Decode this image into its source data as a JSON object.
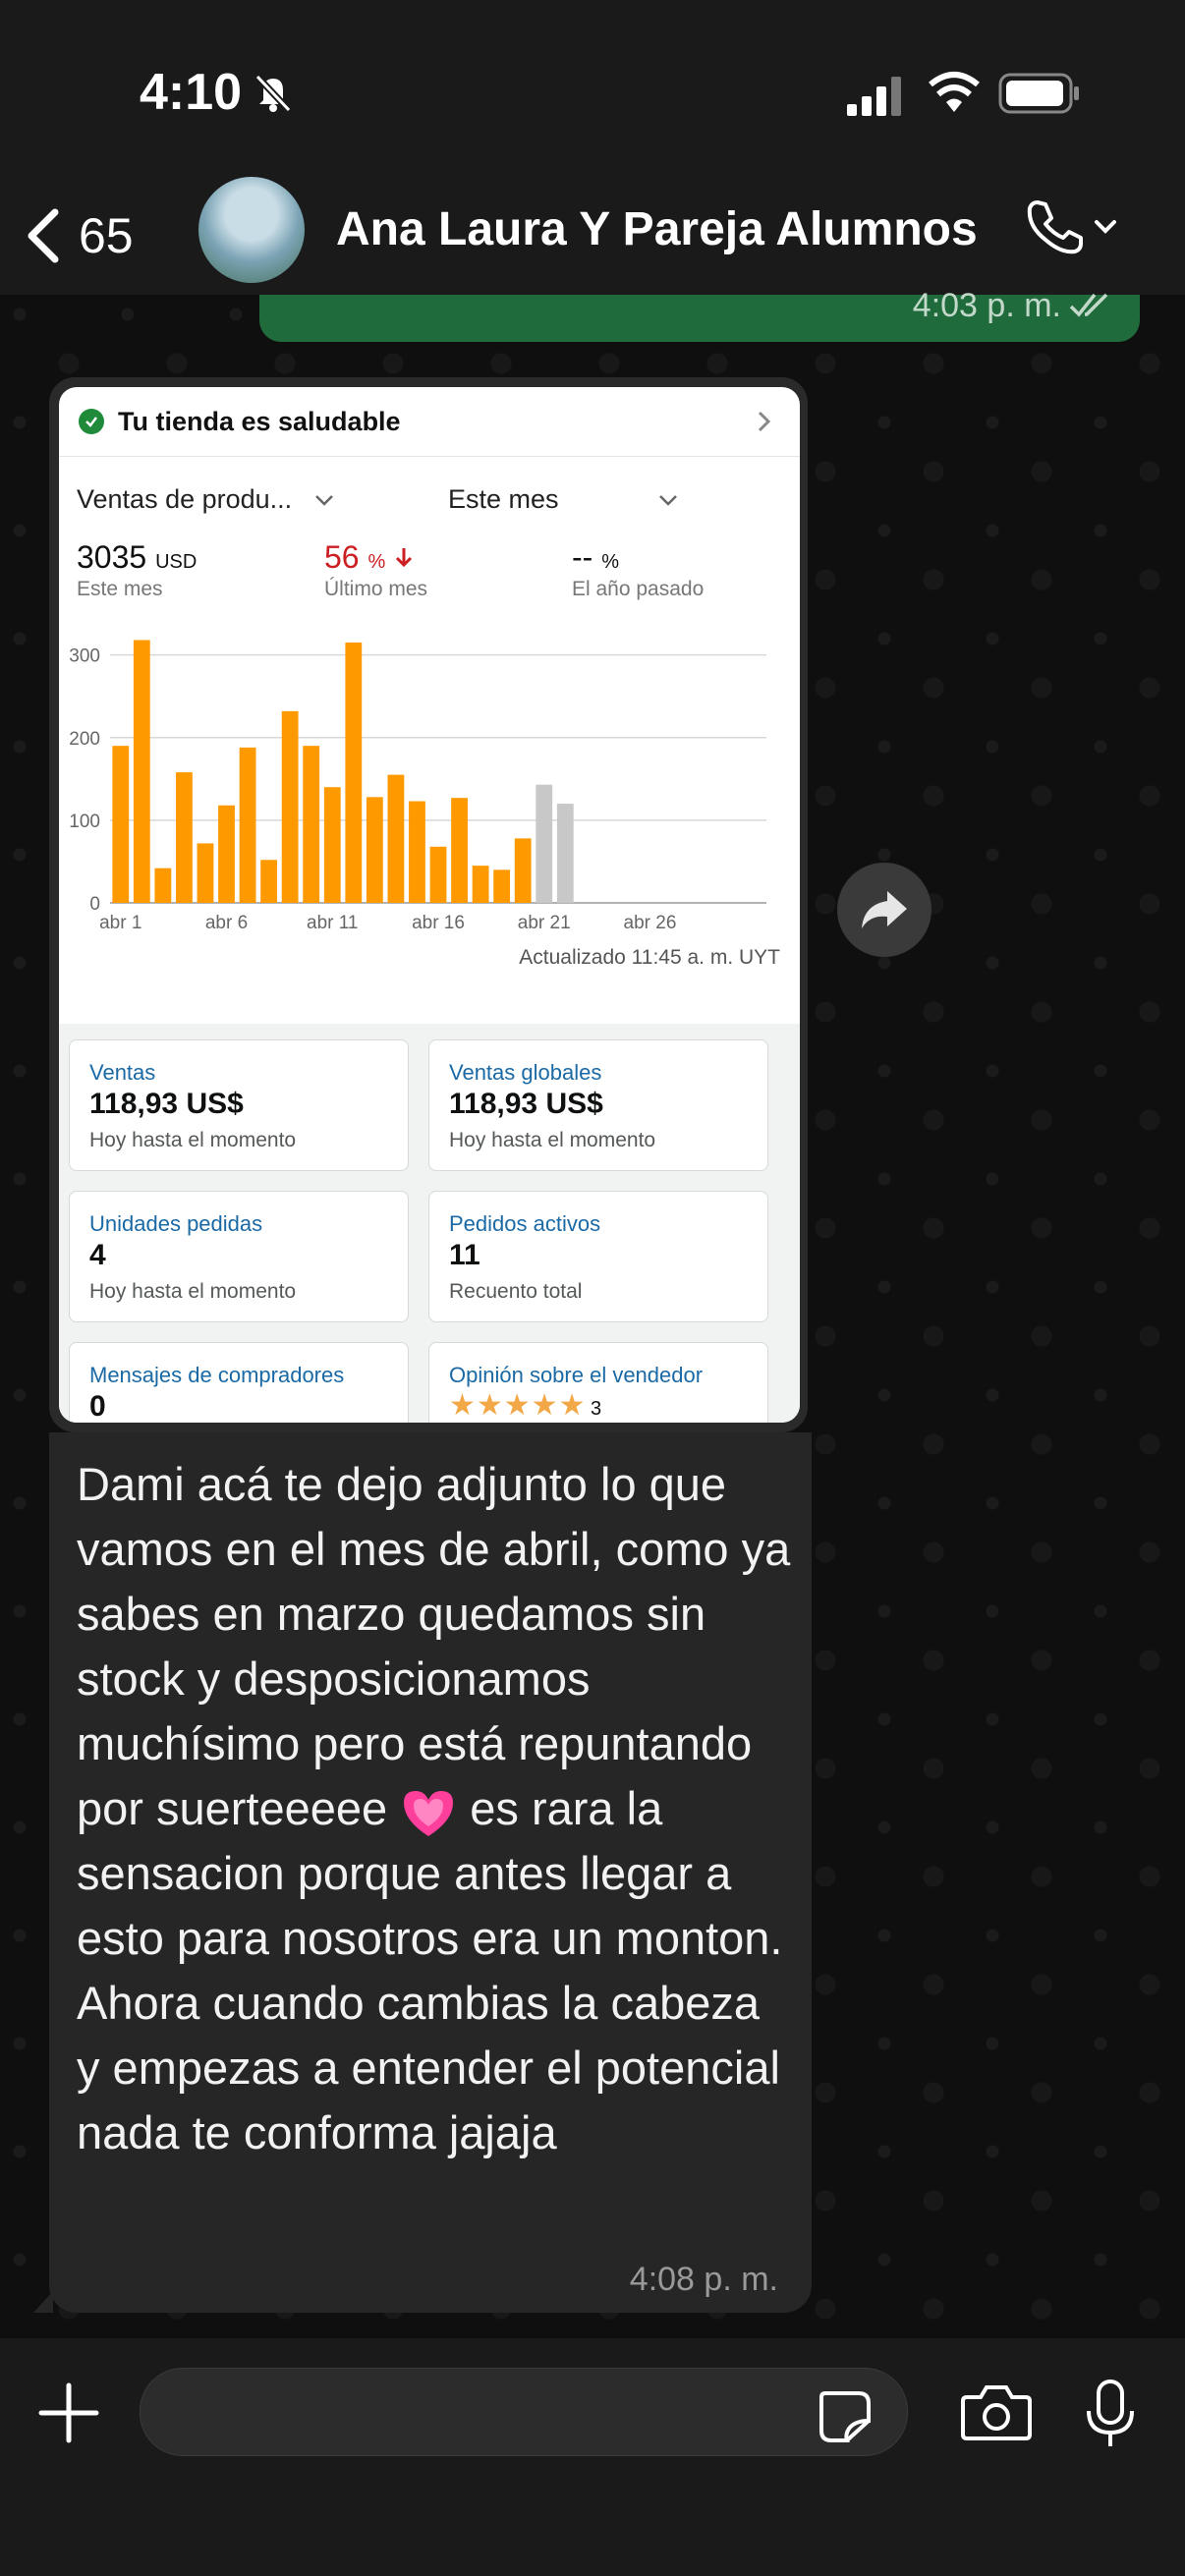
{
  "status": {
    "time": "4:10"
  },
  "header": {
    "back_count": "65",
    "title": "Ana Laura Y Pareja Alumnos"
  },
  "prev_message": {
    "time": "4:03 p. m."
  },
  "screenshot": {
    "health": "Tu tienda es saludable",
    "filter_left": "Ventas de produ...",
    "filter_right": "Este mes",
    "metrics": [
      {
        "value": "3035",
        "unit": "USD",
        "label": "Este mes"
      },
      {
        "value": "56",
        "unit": "%",
        "label": "Último mes"
      },
      {
        "value": "--",
        "unit": "%",
        "label": "El año pasado"
      }
    ],
    "updated": "Actualizado 11:45 a. m. UYT",
    "cards": [
      {
        "label": "Ventas",
        "value": "118,93 US$",
        "sub": "Hoy hasta el momento"
      },
      {
        "label": "Ventas globales",
        "value": "118,93 US$",
        "sub": "Hoy hasta el momento"
      },
      {
        "label": "Unidades pedidas",
        "value": "4",
        "sub": "Hoy hasta el momento"
      },
      {
        "label": "Pedidos activos",
        "value": "11",
        "sub": "Recuento total"
      },
      {
        "label": "Mensajes de compradores",
        "value": "0"
      },
      {
        "label": "Opinión sobre el vendedor",
        "stars": "★★★★★",
        "count": "3"
      }
    ]
  },
  "message": {
    "text": "Dami acá te dejo adjunto lo que vamos en el mes de abril, como ya sabes en marzo quedamos sin stock y desposicionamos muchísimo pero está repuntando por suerteeeee",
    "text_after": "es rara la sensacion porque antes llegar a esto para nosotros era un monton. Ahora cuando cambias la cabeza y empezas a entender el potencial nada te conforma jajaja",
    "time": "4:08 p. m."
  },
  "chart_data": {
    "type": "bar",
    "x": [
      1,
      2,
      3,
      4,
      5,
      6,
      7,
      8,
      9,
      10,
      11,
      12,
      13,
      14,
      15,
      16,
      17,
      18,
      19,
      20,
      21,
      22
    ],
    "values": [
      190,
      318,
      42,
      158,
      72,
      118,
      188,
      52,
      232,
      190,
      140,
      315,
      128,
      155,
      123,
      68,
      127,
      45,
      40,
      78,
      143,
      120
    ],
    "highlight_color": "#ff9900",
    "projected_from_index": 20,
    "projected_color": "#c8c8c8",
    "xtick_labels": [
      "abr 1",
      "abr 6",
      "abr 11",
      "abr 16",
      "abr 21",
      "abr 26"
    ],
    "xtick_positions": [
      1,
      6,
      11,
      16,
      21,
      26
    ],
    "yticks": [
      0,
      100,
      200,
      300
    ],
    "ylim": [
      0,
      340
    ],
    "xlim": [
      0.5,
      31.5
    ],
    "grid": true
  }
}
